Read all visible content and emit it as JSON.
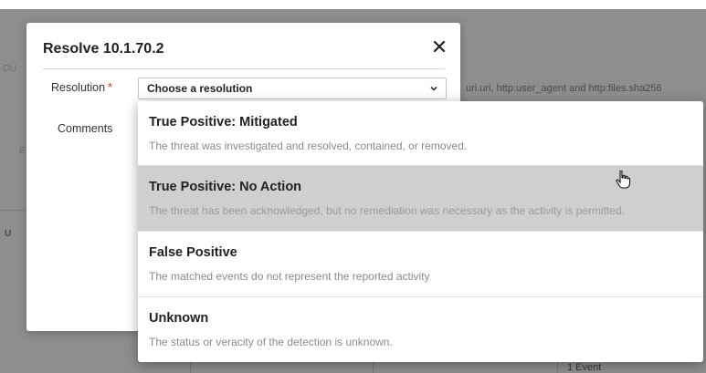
{
  "background": {
    "query_fragment": "uri.uri, http:user_agent and http:files.sha256",
    "side_fragment_1": "OU",
    "side_fragment_2": "E",
    "side_fragment_3": "U",
    "event_count": "1 Event"
  },
  "modal": {
    "title": "Resolve 10.1.70.2",
    "close_label": "✕",
    "resolution_label": "Resolution",
    "required_mark": "*",
    "resolution_placeholder": "Choose a resolution",
    "comments_label": "Comments"
  },
  "dropdown": {
    "options": [
      {
        "title": "True Positive: Mitigated",
        "description": "The threat was investigated and resolved, contained, or removed."
      },
      {
        "title": "True Positive: No Action",
        "description": "The threat has been acknowledged, but no remediation was necessary as the activity is permitted."
      },
      {
        "title": "False Positive",
        "description": "The matched events do not represent the reported activity"
      },
      {
        "title": "Unknown",
        "description": "The status or veracity of the detection is unknown."
      }
    ],
    "highlighted_index": 1
  },
  "colors": {
    "overlay": "#8e8e8e",
    "highlight": "#cfcfcf",
    "required": "#d93025"
  }
}
